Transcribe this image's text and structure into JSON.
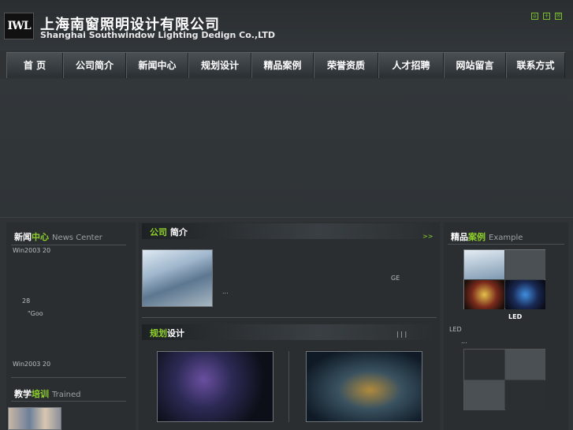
{
  "header": {
    "logo_text": "IWL",
    "company_cn": "上海南窗照明设计有限公司",
    "company_en": "Shanghai Southwindow Lighting Dedign Co.,LTD",
    "icons": [
      "home-icon",
      "bookmark-icon",
      "mail-icon"
    ]
  },
  "nav": [
    "首 页",
    "公司简介",
    "新闻中心",
    "规划设计",
    "精品案例",
    "荣誉资质",
    "人才招聘",
    "网站留言",
    "联系方式"
  ],
  "news": {
    "title_a": "新闻",
    "title_b": "中心",
    "title_en": "News  Center",
    "line1": "Win2003    20",
    "line2": "28",
    "line3": "\"Goo",
    "line4": "Win2003    20"
  },
  "training": {
    "title_a": "教学",
    "title_b": "培训",
    "title_en": "Trained"
  },
  "about": {
    "title_a": "公司",
    "title_b": " 简介",
    "more": ">>",
    "text_ge": "GE",
    "ellipsis": "..."
  },
  "design": {
    "title_a": "规划",
    "title_b": "设计",
    "links": "|     |     |"
  },
  "cases": {
    "title_a": "精品",
    "title_b": "案例",
    "title_en": "Example",
    "led_caption": "LED",
    "led_label": "LED",
    "ellipsis": "..."
  }
}
